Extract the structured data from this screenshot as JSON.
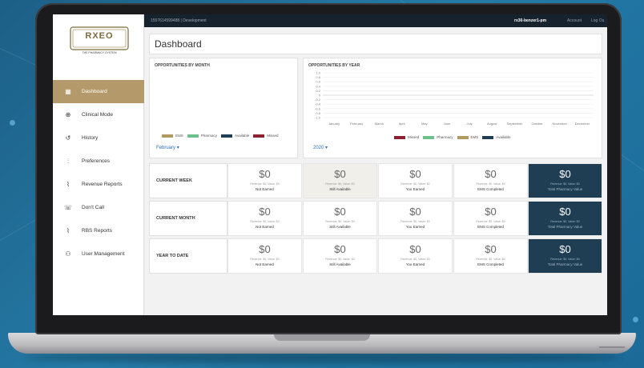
{
  "topbar": {
    "tenant": "1557614599488 | Development",
    "user": "rx30-benzer1-pm",
    "account": "Account",
    "logout": "Log Ou"
  },
  "brand": {
    "logo_text": "RXEO",
    "tagline": "THE PHARMACY SYSTEM"
  },
  "sidebar": {
    "items": [
      {
        "label": "Dashboard",
        "icon": "dashboard-icon",
        "active": true
      },
      {
        "label": "Clinical Mode",
        "icon": "plus-circle-icon"
      },
      {
        "label": "History",
        "icon": "history-icon"
      },
      {
        "label": "Preferences",
        "icon": "sliders-icon"
      },
      {
        "label": "Revenue Reports",
        "icon": "line-chart-icon"
      },
      {
        "label": "Don't Call",
        "icon": "phone-icon"
      },
      {
        "label": "RBS Reports",
        "icon": "line-chart-icon"
      },
      {
        "label": "User Management",
        "icon": "users-icon"
      }
    ]
  },
  "page": {
    "title": "Dashboard"
  },
  "month_card": {
    "title": "OPPORTUNITIES BY MONTH",
    "legend": [
      {
        "label": "EMS",
        "color": "#b09a62"
      },
      {
        "label": "Pharmacy",
        "color": "#6cc08b"
      },
      {
        "label": "Available",
        "color": "#1f3e54"
      },
      {
        "label": "Missed",
        "color": "#8a2232"
      }
    ],
    "selected_month": "February"
  },
  "year_card": {
    "title": "OPPORTUNITIES BY YEAR",
    "selected_year": "2020",
    "legend": [
      {
        "label": "Missed",
        "color": "#8a2232"
      },
      {
        "label": "Pharmacy",
        "color": "#6cc08b"
      },
      {
        "label": "EMS",
        "color": "#b09a62"
      },
      {
        "label": "Available",
        "color": "#1f3e54"
      }
    ]
  },
  "chart_data": {
    "type": "line",
    "title": "OPPORTUNITIES BY YEAR",
    "categories": [
      "January",
      "February",
      "March",
      "April",
      "May",
      "June",
      "July",
      "August",
      "September",
      "October",
      "November",
      "December"
    ],
    "y_ticks": [
      "1.0",
      "0.8",
      "0.6",
      "0.4",
      "0.2",
      "0",
      "-0.2",
      "-0.4",
      "-0.6",
      "-0.8",
      "-1.0"
    ],
    "ylim": [
      -1.0,
      1.0
    ],
    "grid": true,
    "legend_position": "bottom"
  },
  "rows": [
    {
      "label": "CURRENT WEEK",
      "metrics": [
        {
          "value": "$0",
          "sub": "Revenue: $0, Value: $0",
          "label": "Not Earned"
        },
        {
          "value": "$0",
          "sub": "Revenue: $0, Value: $0",
          "label": "Still Available"
        },
        {
          "value": "$0",
          "sub": "Revenue: $0, Value: $0",
          "label": "You Earned"
        },
        {
          "value": "$0",
          "sub": "Revenue: $0, Value: $0",
          "label": "EMS Completed"
        },
        {
          "value": "$0",
          "sub": "Revenue: $0, Value: $0",
          "label": "Total Pharmacy Value"
        }
      ]
    },
    {
      "label": "CURRENT MONTH",
      "metrics": [
        {
          "value": "$0",
          "sub": "Revenue: $0, Value: $0",
          "label": "Not Earned"
        },
        {
          "value": "$0",
          "sub": "Revenue: $0, Value: $0",
          "label": "Still Available"
        },
        {
          "value": "$0",
          "sub": "Revenue: $0, Value: $0",
          "label": "You Earned"
        },
        {
          "value": "$0",
          "sub": "Revenue: $0, Value: $0",
          "label": "EMS Completed"
        },
        {
          "value": "$0",
          "sub": "Revenue: $0, Value: $0",
          "label": "Total Pharmacy Value"
        }
      ]
    },
    {
      "label": "YEAR TO DATE",
      "metrics": [
        {
          "value": "$0",
          "sub": "Revenue: $0, Value: $0",
          "label": "Not Earned"
        },
        {
          "value": "$0",
          "sub": "Revenue: $0, Value: $0",
          "label": "Still Available"
        },
        {
          "value": "$0",
          "sub": "Revenue: $0, Value: $0",
          "label": "You Earned"
        },
        {
          "value": "$0",
          "sub": "Revenue: $0, Value: $0",
          "label": "EMS Completed"
        },
        {
          "value": "$0",
          "sub": "Revenue: $0, Value: $0",
          "label": "Total Pharmacy Value"
        }
      ]
    }
  ]
}
